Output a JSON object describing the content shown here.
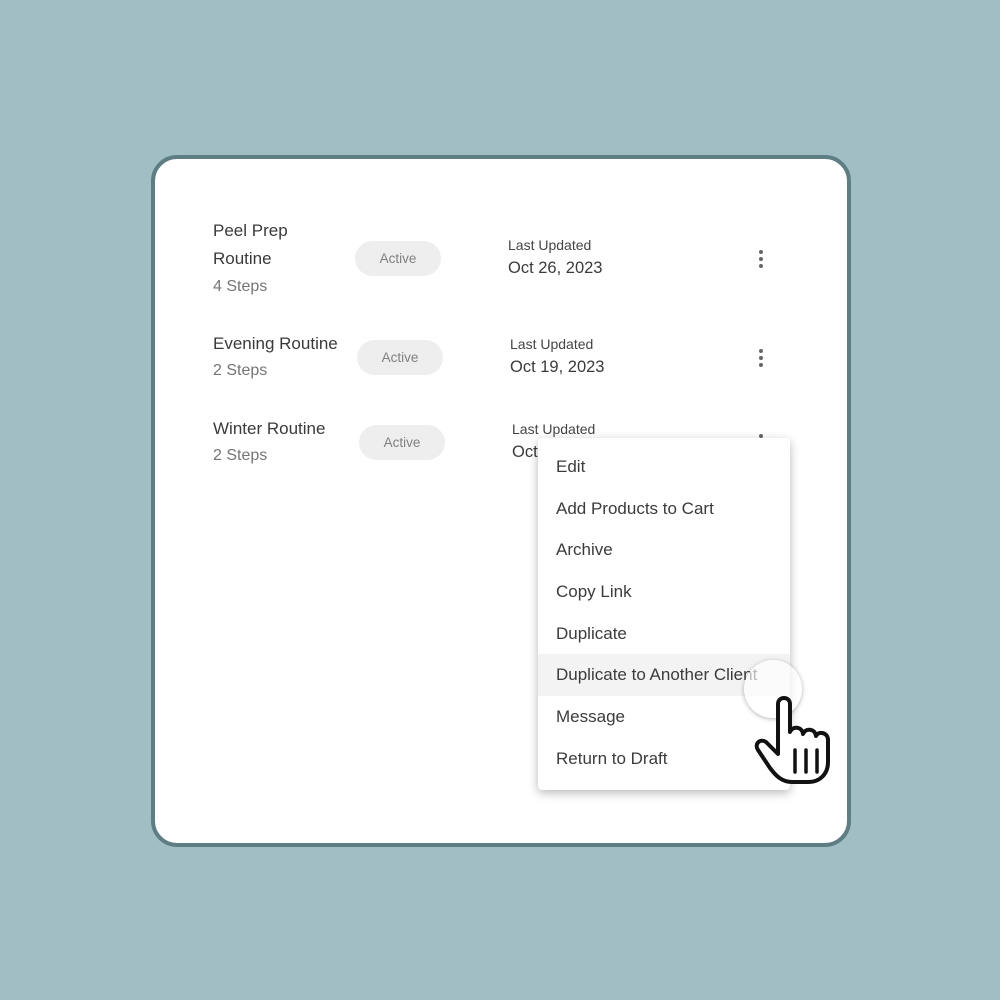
{
  "routines": [
    {
      "name_line1": "Peel Prep",
      "name_line2": "Routine",
      "steps": "4 Steps",
      "status": "Active",
      "updated_label": "Last Updated",
      "updated_date": "Oct 26, 2023"
    },
    {
      "name_line1": "Evening Routine",
      "steps": "2 Steps",
      "status": "Active",
      "updated_label": "Last Updated",
      "updated_date": "Oct 19, 2023"
    },
    {
      "name_line1": "Winter Routine",
      "steps": "2 Steps",
      "status": "Active",
      "updated_label": "Last Updated",
      "updated_date": "Oct"
    }
  ],
  "menu": {
    "items": [
      "Edit",
      "Add Products to Cart",
      "Archive",
      "Copy Link",
      "Duplicate",
      "Duplicate to Another Client",
      "Message",
      "Return to Draft"
    ],
    "hovered_item": "Duplicate to Another Client"
  },
  "colors": {
    "background": "#a2bec5",
    "card_border": "#5f7e84",
    "badge_bg": "#eeeeee",
    "menu_hover": "#f3f3f3"
  },
  "icons": [
    "kebab-menu-icon",
    "hand-pointer-cursor-icon"
  ]
}
